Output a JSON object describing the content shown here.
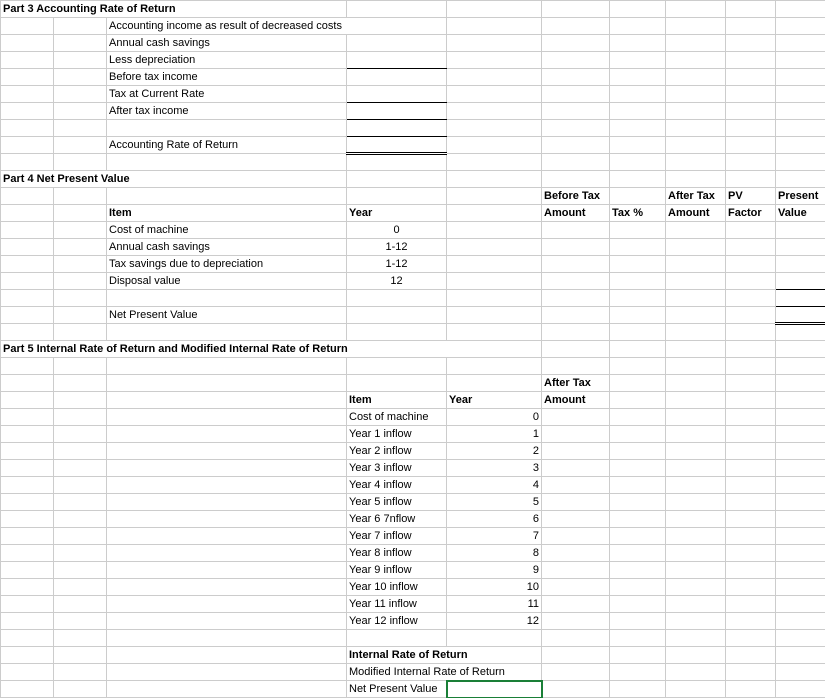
{
  "part3": {
    "title": "Part 3 Accounting Rate of Return",
    "rows": [
      "Accounting income as result of decreased costs",
      "Annual cash savings",
      "Less depreciation",
      "Before tax income",
      "Tax at Current Rate",
      "After tax income",
      "",
      "Accounting Rate of Return"
    ]
  },
  "part4": {
    "title": "Part 4 Net Present Value",
    "headers": {
      "item": "Item",
      "year": "Year",
      "before_tax_amount_1": "Before Tax",
      "before_tax_amount_2": "Amount",
      "tax_pct": "Tax %",
      "after_tax_amount_1": "After Tax",
      "after_tax_amount_2": "Amount",
      "pv_factor_1": "PV",
      "pv_factor_2": "Factor",
      "present_value_1": "Present",
      "present_value_2": "Value"
    },
    "rows": [
      {
        "item": "Cost of machine",
        "year": "0"
      },
      {
        "item": "Annual cash savings",
        "year": "1-12"
      },
      {
        "item": "Tax savings due to depreciation",
        "year": "1-12"
      },
      {
        "item": "Disposal value",
        "year": "12"
      }
    ],
    "footer": "Net Present Value"
  },
  "part5": {
    "title": "Part 5 Internal Rate of Return and Modified Internal Rate of Return",
    "headers": {
      "item": "Item",
      "year": "Year",
      "after_tax_amount_1": "After Tax",
      "after_tax_amount_2": "Amount"
    },
    "rows": [
      {
        "item": "Cost of machine",
        "year": "0"
      },
      {
        "item": "Year 1 inflow",
        "year": "1"
      },
      {
        "item": "Year 2 inflow",
        "year": "2"
      },
      {
        "item": "Year 3 inflow",
        "year": "3"
      },
      {
        "item": "Year 4 inflow",
        "year": "4"
      },
      {
        "item": "Year 5 inflow",
        "year": "5"
      },
      {
        "item": "Year 6 7nflow",
        "year": "6"
      },
      {
        "item": "Year 7 inflow",
        "year": "7"
      },
      {
        "item": "Year 8 inflow",
        "year": "8"
      },
      {
        "item": "Year 9 inflow",
        "year": "9"
      },
      {
        "item": "Year 10 inflow",
        "year": "10"
      },
      {
        "item": "Year 11 inflow",
        "year": "11"
      },
      {
        "item": "Year 12 inflow",
        "year": "12"
      }
    ],
    "footers": {
      "irr": "Internal Rate of Return",
      "mirr": "Modified Internal Rate of Return",
      "npv": "Net Present Value"
    }
  }
}
